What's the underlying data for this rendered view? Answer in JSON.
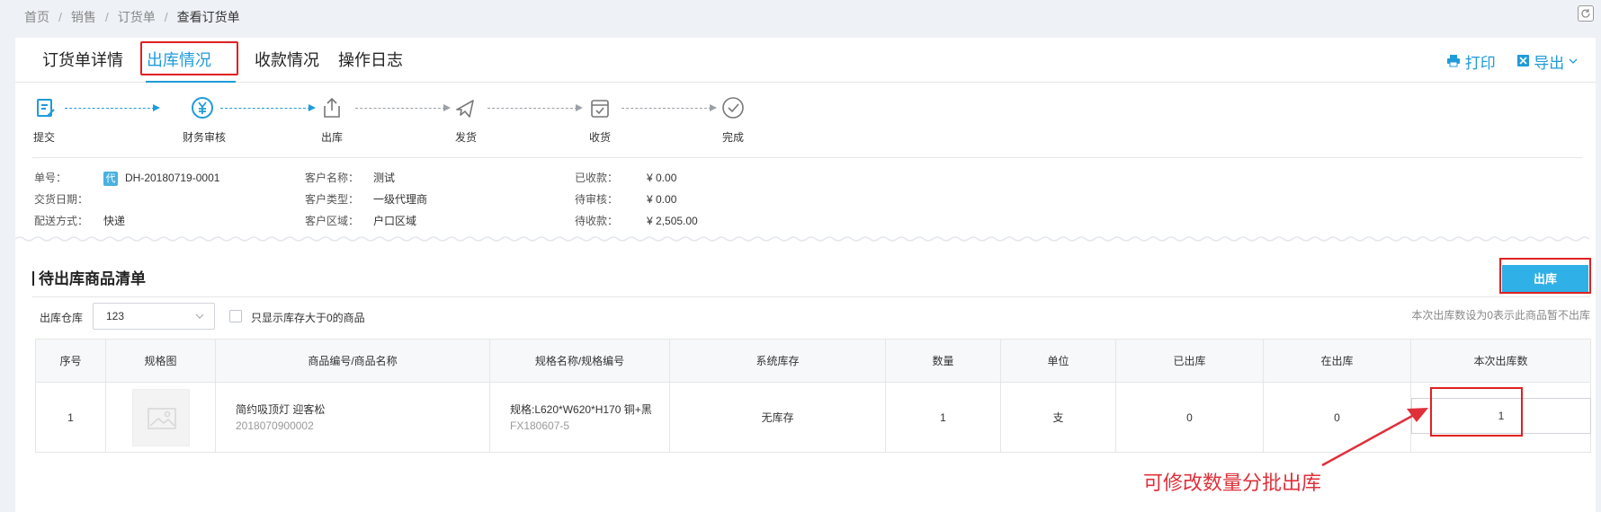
{
  "breadcrumb": [
    "首页",
    "销售",
    "订货单",
    "查看订货单"
  ],
  "tabs": [
    {
      "label": "订货单详情"
    },
    {
      "label": "出库情况"
    },
    {
      "label": "收款情况"
    },
    {
      "label": "操作日志"
    }
  ],
  "actions": {
    "print": "打印",
    "export": "导出"
  },
  "steps": [
    {
      "label": "提交",
      "icon": "edit-doc-icon",
      "state": "done"
    },
    {
      "label": "财务审核",
      "icon": "yuan-icon",
      "state": "done"
    },
    {
      "label": "出库",
      "icon": "upload-icon",
      "state": "pending"
    },
    {
      "label": "发货",
      "icon": "airplane-icon",
      "state": "pending"
    },
    {
      "label": "收货",
      "icon": "inbox-icon",
      "state": "pending"
    },
    {
      "label": "完成",
      "icon": "check-circle-icon",
      "state": "pending"
    }
  ],
  "order": {
    "no_label": "单号：",
    "badge": "代",
    "no": "DH-20180719-0001",
    "date_label": "交货日期：",
    "date": "",
    "ship_label": "配送方式：",
    "ship": "快递",
    "customer_label": "客户名称：",
    "customer": "测试",
    "type_label": "客户类型：",
    "type": "一级代理商",
    "region_label": "客户区域：",
    "region": "户口区域",
    "received_label": "已收款：",
    "received": "¥ 0.00",
    "pending_review_label": "待审核：",
    "pending_review": "¥ 0.00",
    "due_label": "待收款：",
    "due": "¥ 2,505.00"
  },
  "section": {
    "title": "待出库商品清单",
    "outbound_button": "出库",
    "warehouse_label": "出库仓库",
    "warehouse_value": "123",
    "filter_label": "只显示库存大于0的商品",
    "hint": "本次出库数设为0表示此商品暂不出库"
  },
  "table": {
    "headers": [
      "序号",
      "规格图",
      "商品编号/商品名称",
      "规格名称/规格编号",
      "系统库存",
      "数量",
      "单位",
      "已出库",
      "在出库",
      "本次出库数"
    ],
    "rows": [
      {
        "index": "1",
        "product_name": "简约吸顶灯 迎客松",
        "product_code": "2018070900002",
        "spec_name": "规格:L620*W620*H170 铜+黑",
        "spec_code": "FX180607-5",
        "stock": "无库存",
        "qty": "1",
        "unit": "支",
        "shipped": "0",
        "shipping": "0",
        "this_out": "1"
      }
    ]
  },
  "annotation": "可修改数量分批出库",
  "colors": {
    "accent": "#1f9bd9",
    "highlight": "#e02020",
    "button": "#2fb0e6"
  }
}
